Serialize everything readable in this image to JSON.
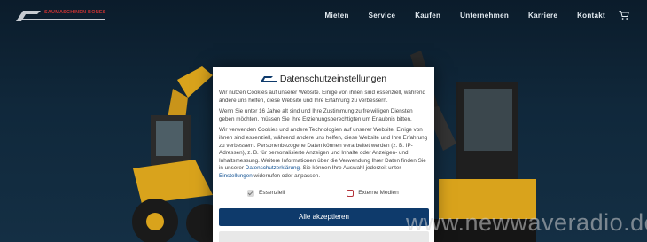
{
  "header": {
    "logo_text": "SAUMASCHINEN BONES",
    "nav": [
      "Mieten",
      "Service",
      "Kaufen",
      "Unternehmen",
      "Karriere",
      "Kontakt"
    ]
  },
  "colors": {
    "background": "#0d2233",
    "accent": "#0e3a6b",
    "brand_red": "#c93333",
    "machine_yellow": "#d9a31c"
  },
  "consent": {
    "title": "Datenschutzeinstellungen",
    "p1": "Wir nutzen Cookies auf unserer Website. Einige von ihnen sind essenziell, während andere uns helfen, diese Website und Ihre Erfahrung zu verbessern.",
    "p2": "Wenn Sie unter 16 Jahre alt sind und Ihre Zustimmung zu freiwilligen Diensten geben möchten, müssen Sie Ihre Erziehungsberechtigten um Erlaubnis bitten.",
    "p3_a": "Wir verwenden Cookies und andere Technologien auf unserer Website. Einige von ihnen sind essenziell, während andere uns helfen, diese Website und Ihre Erfahrung zu verbessern. Personenbezogene Daten können verarbeitet werden (z. B. IP-Adressen), z. B. für personalisierte Anzeigen und Inhalte oder Anzeigen- und Inhaltsmessung. Weitere Informationen über die Verwendung Ihrer Daten finden Sie in unserer ",
    "p3_link1": "Datenschutzerklärung",
    "p3_b": ". Sie können Ihre Auswahl jederzeit unter ",
    "p3_link2": "Einstellungen",
    "p3_c": " widerrufen oder anpassen.",
    "essential_label": "Essenziell",
    "essential_checked": true,
    "external_label": "Externe Medien",
    "external_checked": false,
    "accept_all": "Alle akzeptieren"
  },
  "watermark": "www.newwaveradio.de"
}
